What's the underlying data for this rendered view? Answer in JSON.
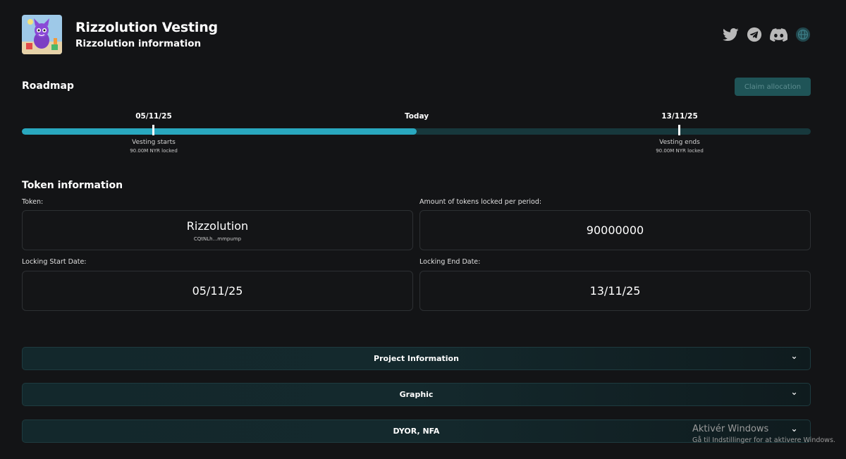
{
  "header": {
    "title": "Rizzolution Vesting",
    "subtitle": "Rizzolution information",
    "logo_icon": "purple-cat-logo",
    "social_icons": [
      "twitter-icon",
      "telegram-icon",
      "discord-icon",
      "globe-icon"
    ]
  },
  "roadmap": {
    "title": "Roadmap",
    "claim_button": "Claim allocation",
    "progress": 0.5,
    "start": {
      "date": "05/11/25",
      "label": "Vesting starts",
      "sublabel": "90.00M NYR locked"
    },
    "today": {
      "label": "Today"
    },
    "end": {
      "date": "13/11/25",
      "label": "Vesting ends",
      "sublabel": "90.00M NYR locked"
    }
  },
  "token_info": {
    "title": "Token information",
    "token_label": "Token:",
    "token_name": "Rizzolution",
    "token_address": "CQtNLh...mmpump",
    "amount_label": "Amount of tokens locked per period:",
    "amount_value": "90000000",
    "start_label": "Locking Start Date:",
    "start_value": "05/11/25",
    "end_label": "Locking End Date:",
    "end_value": "13/11/25"
  },
  "accordions": [
    "Project Information",
    "Graphic",
    "DYOR, NFA"
  ],
  "watermark": {
    "title": "Aktivér Windows",
    "subtitle": "Gå til Indstillinger for at aktivere Windows."
  },
  "colors": {
    "background": "#131416",
    "accent": "#29a8bf",
    "track": "#17383c",
    "claim_button": "#1f5457"
  }
}
